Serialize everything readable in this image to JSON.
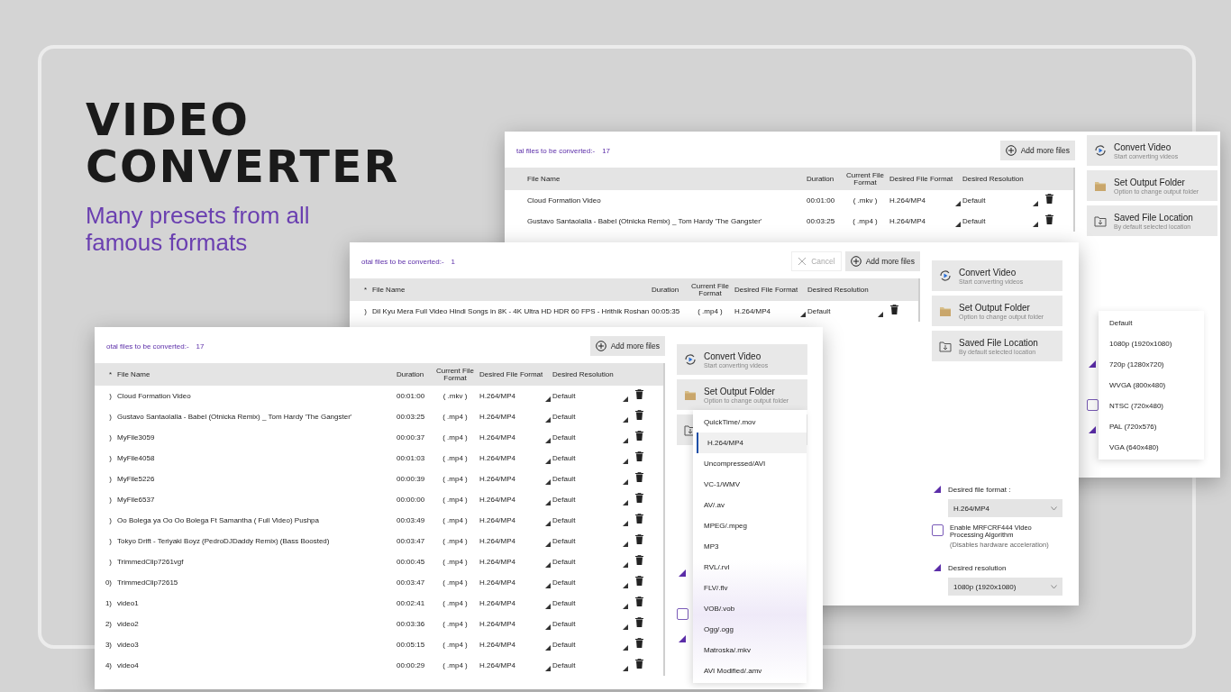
{
  "headline": {
    "title_lines": [
      "VIDEO",
      "CONVERTER"
    ],
    "subtitle": "Many presets from all famous formats"
  },
  "windows": [
    {
      "count_label": "tal files to be converted:-",
      "count": "17",
      "add_button": "Add more files",
      "columns": [
        {
          "kind": "name",
          "label": "File Name"
        },
        {
          "kind": "duration",
          "label": "Duration"
        },
        {
          "kind": "current",
          "label": "Current File Format"
        },
        {
          "kind": "desired",
          "label": "Desired File Format"
        },
        {
          "kind": "resolution",
          "label": "Desired Resolution"
        }
      ],
      "rows": [
        {
          "name": "Cloud Formation Video",
          "duration": "00:01:00",
          "current_format": "( .mkv )",
          "desired_format": "H.264/MP4",
          "resolution": "Default"
        },
        {
          "name": "Gustavo Santaolalla - Babel (Otnicka Remix) _ Tom Hardy 'The Gangster'",
          "duration": "00:03:25",
          "current_format": "( .mp4 )",
          "desired_format": "H.264/MP4",
          "resolution": "Default"
        }
      ],
      "actions": [
        {
          "title": "Convert Video",
          "subtitle": "Start converting videos"
        },
        {
          "title": "Set Output Folder",
          "subtitle": "Option to change output folder"
        },
        {
          "title": "Saved File Location",
          "subtitle": "By default selected location"
        }
      ],
      "settings": {
        "checked": false
      },
      "dropdown": {
        "kind": "resolution",
        "items": [
          {
            "label": "Default",
            "selected": false
          },
          {
            "label": "1080p (1920x1080)",
            "selected": false
          },
          {
            "label": "720p (1280x720)",
            "selected": false
          },
          {
            "label": "WVGA (800x480)",
            "selected": false
          },
          {
            "label": "NTSC (720x480)",
            "selected": false
          },
          {
            "label": "PAL (720x576)",
            "selected": false
          },
          {
            "label": "VGA (640x480)",
            "selected": false
          }
        ]
      }
    },
    {
      "count_label": "otal files to be converted:-",
      "count": "1",
      "cancel_button": {
        "label": "Cancel",
        "disabled": true
      },
      "add_button": "Add more files",
      "columns": [
        {
          "kind": "index",
          "label": "*"
        },
        {
          "kind": "name",
          "label": "File Name"
        },
        {
          "kind": "duration",
          "label": "Duration"
        },
        {
          "kind": "current",
          "label": "Current File Format"
        },
        {
          "kind": "desired",
          "label": "Desired File Format"
        },
        {
          "kind": "resolution",
          "label": "Desired Resolution"
        }
      ],
      "rows": [
        {
          "index": ")",
          "name": "Dil Kyu Mera Full Video Hindi Songs in 8K - 4K Ultra HD HDR 60 FPS - Hrithik Roshan",
          "duration": "00:05:35",
          "current_format": "( .mp4 )",
          "desired_format": "H.264/MP4",
          "resolution": "Default"
        }
      ],
      "actions": [
        {
          "title": "Convert Video",
          "subtitle": "Start converting videos"
        },
        {
          "title": "Set Output Folder",
          "subtitle": "Option to change output folder"
        },
        {
          "title": "Saved File Location",
          "subtitle": "By default selected location"
        }
      ],
      "settings": {
        "format_label": "Desired file format :",
        "format_value": "H.264/MP4",
        "checkbox_label": "Enable MRFCRF444 Video Processing Algorithm",
        "checkbox_note": "(Disables hardware acceleration)",
        "checked": false,
        "resolution_label": "Desired resolution",
        "resolution_value": "1080p (1920x1080)"
      }
    },
    {
      "count_label": "otal files to be converted:-",
      "count": "17",
      "add_button": "Add more files",
      "columns": [
        {
          "kind": "index",
          "label": "*"
        },
        {
          "kind": "name",
          "label": "File Name"
        },
        {
          "kind": "duration",
          "label": "Duration"
        },
        {
          "kind": "current",
          "label": "Current File Format"
        },
        {
          "kind": "desired",
          "label": "Desired File Format"
        },
        {
          "kind": "resolution",
          "label": "Desired Resolution"
        }
      ],
      "rows": [
        {
          "index": ")",
          "name": "Cloud Formation Video",
          "duration": "00:01:00",
          "current_format": "( .mkv )",
          "desired_format": "H.264/MP4",
          "resolution": "Default"
        },
        {
          "index": ")",
          "name": "Gustavo Santaolalla - Babel (Otnicka Remix) _ Tom Hardy 'The Gangster'",
          "duration": "00:03:25",
          "current_format": "( .mp4 )",
          "desired_format": "H.264/MP4",
          "resolution": "Default"
        },
        {
          "index": ")",
          "name": "MyFile3059",
          "duration": "00:00:37",
          "current_format": "( .mp4 )",
          "desired_format": "H.264/MP4",
          "resolution": "Default"
        },
        {
          "index": ")",
          "name": "MyFile4058",
          "duration": "00:01:03",
          "current_format": "( .mp4 )",
          "desired_format": "H.264/MP4",
          "resolution": "Default"
        },
        {
          "index": ")",
          "name": "MyFile5226",
          "duration": "00:00:39",
          "current_format": "( .mp4 )",
          "desired_format": "H.264/MP4",
          "resolution": "Default"
        },
        {
          "index": ")",
          "name": "MyFile6537",
          "duration": "00:00:00",
          "current_format": "( .mp4 )",
          "desired_format": "H.264/MP4",
          "resolution": "Default"
        },
        {
          "index": ")",
          "name": "Oo Bolega ya Oo Oo Bolega Ft Samantha ( Full Video) Pushpa",
          "duration": "00:03:49",
          "current_format": "( .mp4 )",
          "desired_format": "H.264/MP4",
          "resolution": "Default"
        },
        {
          "index": ")",
          "name": "Tokyo Drift - Teriyaki Boyz (PedroDJDaddy Remix) (Bass Boosted)",
          "duration": "00:03:47",
          "current_format": "( .mp4 )",
          "desired_format": "H.264/MP4",
          "resolution": "Default"
        },
        {
          "index": ")",
          "name": "TrimmedClip7261vgf",
          "duration": "00:00:45",
          "current_format": "( .mp4 )",
          "desired_format": "H.264/MP4",
          "resolution": "Default"
        },
        {
          "index": "0)",
          "name": "TrimmedClip72615",
          "duration": "00:03:47",
          "current_format": "( .mp4 )",
          "desired_format": "H.264/MP4",
          "resolution": "Default"
        },
        {
          "index": "1)",
          "name": "video1",
          "duration": "00:02:41",
          "current_format": "( .mp4 )",
          "desired_format": "H.264/MP4",
          "resolution": "Default"
        },
        {
          "index": "2)",
          "name": "video2",
          "duration": "00:03:36",
          "current_format": "( .mp4 )",
          "desired_format": "H.264/MP4",
          "resolution": "Default"
        },
        {
          "index": "3)",
          "name": "video3",
          "duration": "00:05:15",
          "current_format": "( .mp4 )",
          "desired_format": "H.264/MP4",
          "resolution": "Default"
        },
        {
          "index": "4)",
          "name": "video4",
          "duration": "00:00:29",
          "current_format": "( .mp4 )",
          "desired_format": "H.264/MP4",
          "resolution": "Default"
        }
      ],
      "actions": [
        {
          "title": "Convert Video",
          "subtitle": "Start converting videos"
        },
        {
          "title": "Set Output Folder",
          "subtitle": "Option to change output folder"
        }
      ],
      "settings": {
        "checked": false
      },
      "dropdown": {
        "kind": "format",
        "items": [
          {
            "label": "QuickTime/.mov",
            "selected": false
          },
          {
            "label": "H.264/MP4",
            "selected": true
          },
          {
            "label": "Uncompressed/AVI",
            "selected": false
          },
          {
            "label": "VC-1/WMV",
            "selected": false
          },
          {
            "label": "AV/.av",
            "selected": false
          },
          {
            "label": "MPEG/.mpeg",
            "selected": false
          },
          {
            "label": "MP3",
            "selected": false
          },
          {
            "label": "RVL/.rvl",
            "selected": false
          },
          {
            "label": "FLV/.flv",
            "selected": false
          },
          {
            "label": "VOB/.vob",
            "selected": false
          },
          {
            "label": "Ogg/.ogg",
            "selected": false
          },
          {
            "label": "Matroska/.mkv",
            "selected": false
          },
          {
            "label": "AVI Modified/.amv",
            "selected": false
          }
        ]
      }
    }
  ]
}
